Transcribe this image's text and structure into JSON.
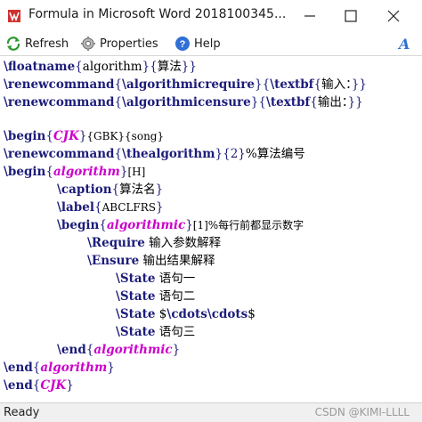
{
  "window": {
    "title": "Formula in Microsoft Word 2018100345..."
  },
  "toolbar": {
    "refresh_label": "Refresh",
    "properties_label": "Properties",
    "help_label": "Help",
    "italic_label": "A"
  },
  "code": {
    "l1": {
      "kw": "\\floatname",
      "b1": "{",
      "a1": "algorithm",
      "b2": "}{",
      "a2": "算法",
      "b3": "}}"
    },
    "l2": {
      "kw": "\\renewcommand",
      "b1": "{",
      "kw2": "\\algorithmicrequire",
      "b2": "}{",
      "kw3": "\\textbf",
      "b3": "{",
      "a1": "输入：",
      "b4": "}}"
    },
    "l3": {
      "kw": "\\renewcommand",
      "b1": "{",
      "kw2": "\\algorithmicensure",
      "b2": "}{",
      "kw3": "\\textbf",
      "b3": "{",
      "a1": "输出：",
      "b4": "}}"
    },
    "l4": {
      "kw": "\\begin",
      "b1": "{",
      "env": "CJK",
      "b2": "}",
      "a1": "{GBK}{song}"
    },
    "l5": {
      "kw": "\\renewcommand",
      "b1": "{",
      "kw2": "\\thealgorithm",
      "b2": "}{2}",
      "a1": "%算法编号"
    },
    "l6": {
      "kw": "\\begin",
      "b1": "{",
      "env": "algorithm",
      "b2": "}",
      "a1": "[H]"
    },
    "l7": {
      "kw": "\\caption",
      "b1": "{",
      "a1": "算法名",
      "b2": "}"
    },
    "l8": {
      "kw": "\\label",
      "b1": "{",
      "a1": "ABCLFRS",
      "b2": "}"
    },
    "l9": {
      "kw": "\\begin",
      "b1": "{",
      "env": "algorithmic",
      "b2": "}",
      "a1": "[1]%每行前都显示数字"
    },
    "l10": {
      "kw": "\\Require",
      "a1": " 输入参数解释"
    },
    "l11": {
      "kw": "\\Ensure",
      "a1": " 输出结果解释"
    },
    "l12": {
      "kw": "\\State",
      "a1": " 语句一"
    },
    "l13": {
      "kw": "\\State",
      "a1": " 语句二"
    },
    "l14": {
      "kw": "\\State",
      "a1": " $",
      "kw2": "\\cdots\\cdots",
      "a2": "$"
    },
    "l15": {
      "kw": "\\State",
      "a1": " 语句三"
    },
    "l16": {
      "kw": "\\end",
      "b1": "{",
      "env": "algorithmic",
      "b2": "}"
    },
    "l17": {
      "kw": "\\end",
      "b1": "{",
      "env": "algorithm",
      "b2": "}"
    },
    "l18": {
      "kw": "\\end",
      "b1": "{",
      "env": "CJK",
      "b2": "}"
    }
  },
  "status": {
    "text": "Ready",
    "watermark": "CSDN @KIMI-LLLL"
  },
  "colors": {
    "keyword": "#1c1c7a",
    "environment": "#cc00cc",
    "refresh_icon": "#2e9a2e",
    "help_icon": "#2f6fd6"
  }
}
